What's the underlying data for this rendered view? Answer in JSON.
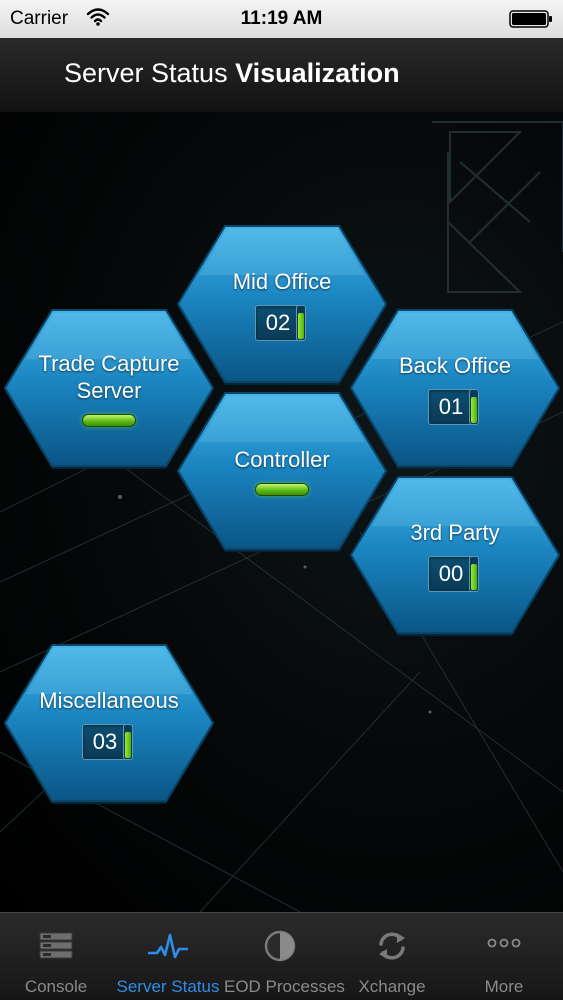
{
  "status_bar": {
    "carrier": "Carrier",
    "time": "11:19 AM"
  },
  "nav": {
    "title_regular": "Server Status",
    "title_bold": "Visualization"
  },
  "servers": [
    {
      "id": "mid-office",
      "label_lines": [
        "Mid Office"
      ],
      "count": "02",
      "gauge_level": 0.8
    },
    {
      "id": "trade-capture-server",
      "label_lines": [
        "Trade Capture",
        "Server"
      ],
      "count": null
    },
    {
      "id": "back-office",
      "label_lines": [
        "Back Office"
      ],
      "count": "01",
      "gauge_level": 0.8
    },
    {
      "id": "controller",
      "label_lines": [
        "Controller"
      ],
      "count": null
    },
    {
      "id": "3rd-party",
      "label_lines": [
        "3rd Party"
      ],
      "count": "00",
      "gauge_level": 0.8
    },
    {
      "id": "miscellaneous",
      "label_lines": [
        "Miscellaneous"
      ],
      "count": "03",
      "gauge_level": 0.8
    }
  ],
  "tabs": [
    {
      "label": "Console",
      "icon": "server-rack-icon",
      "active": false
    },
    {
      "label": "Server Status",
      "icon": "pulse-icon",
      "active": true
    },
    {
      "label": "EOD Processes",
      "icon": "half-circle-icon",
      "active": false
    },
    {
      "label": "Xchange",
      "icon": "sync-arrows-icon",
      "active": false
    },
    {
      "label": "More",
      "icon": "more-dots-icon",
      "active": false
    }
  ],
  "colors": {
    "hex_top": "#3aa6dc",
    "hex_bottom": "#0a5b8c",
    "status_green": "#6ccb1e",
    "active_tab": "#2f8ce8"
  }
}
